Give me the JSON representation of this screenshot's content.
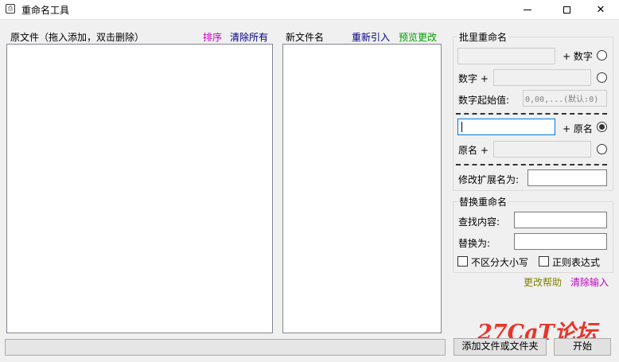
{
  "window": {
    "title": "重命名工具",
    "close_glyph": "✕"
  },
  "source_panel": {
    "title": "原文件（拖入添加，双击删除）",
    "sort_link": "排序",
    "clear_all_link": "清除所有"
  },
  "target_panel": {
    "title": "新文件名",
    "reimport_link": "重新引入",
    "preview_link": "预览更改"
  },
  "batch_rename": {
    "title": "批里重命名",
    "row1": {
      "input_value": "",
      "suffix_label": "+ 数字"
    },
    "row2": {
      "prefix_label": "数字 +",
      "input_value": ""
    },
    "start_value": {
      "label": "数字起始值:",
      "placeholder": "0,00,...(默认:0)"
    },
    "row3": {
      "input_value": "",
      "suffix_label": "+ 原名"
    },
    "row4": {
      "prefix_label": "原名 +",
      "input_value": ""
    },
    "extension": {
      "label": "修改扩展名为:",
      "value": ""
    }
  },
  "replace_rename": {
    "title": "替换重命名",
    "find": {
      "label": "查找内容:",
      "value": ""
    },
    "replace": {
      "label": "替换为:",
      "value": ""
    },
    "case_insensitive_label": "不区分大小写",
    "regex_label": "正则表达式"
  },
  "help_link": "更改帮助",
  "clear_input_link": "清除输入",
  "add_button": "添加文件或文件夹",
  "start_button": "开始",
  "watermark": "27CaT论坛",
  "colors": {
    "sort_link": "#c000c0",
    "clear_all_link": "#000080",
    "reimport_link": "#000080",
    "preview_link": "#00a000",
    "help_link": "#808000",
    "clear_input_link": "#c000c0",
    "watermark": "#e8342a"
  },
  "icons": {
    "app": "rename-tool-icon",
    "minimize": "minimize-icon",
    "maximize": "maximize-icon",
    "close": "close-icon"
  }
}
